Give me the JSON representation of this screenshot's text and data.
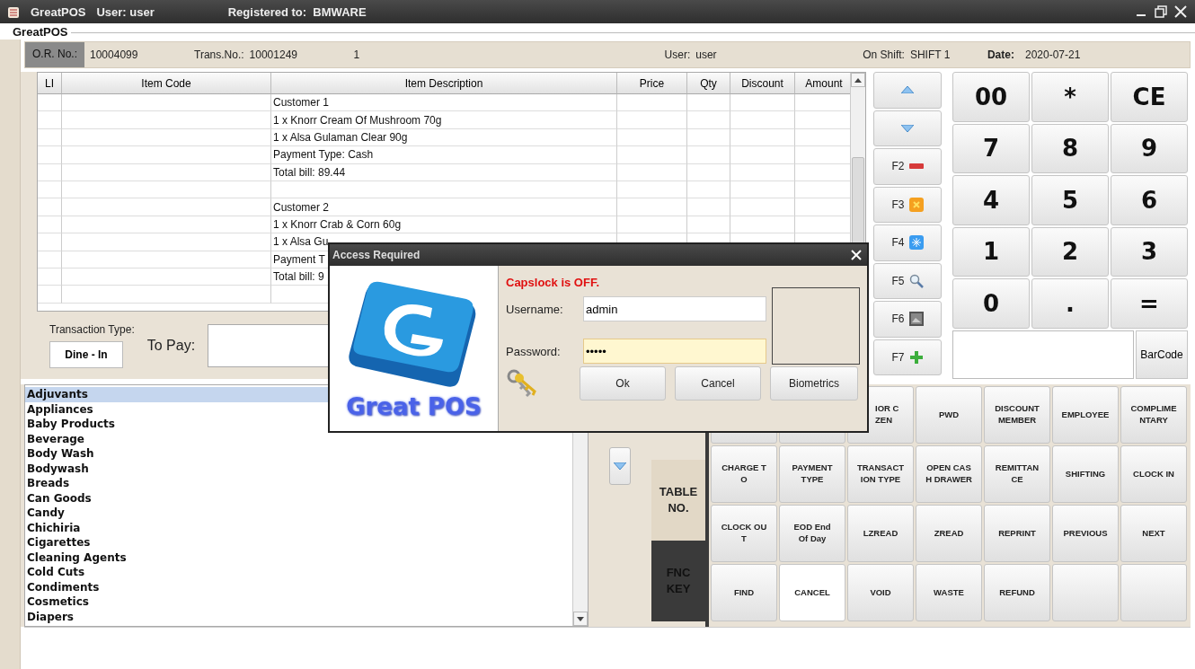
{
  "title_bar": {
    "app": "GreatPOS",
    "user": "User: user",
    "registered": "Registered to:  BMWARE"
  },
  "group_title": "GreatPOS",
  "header": {
    "or_label": "O.R. No.:",
    "or_no": "10004099",
    "trans_label": "Trans.No.:",
    "trans_no": "10001249",
    "counter": "1",
    "user_label": "User:",
    "user": "user",
    "shift_label": "On Shift:",
    "shift": "SHIFT 1",
    "date_label": "Date:",
    "date": "2020-07-21"
  },
  "table": {
    "columns": [
      "LI",
      "Item Code",
      "Item Description",
      "Price",
      "Qty",
      "Discount",
      "Amount"
    ],
    "rows": [
      {
        "kind": "text",
        "description": "Customer 1"
      },
      {
        "kind": "text",
        "description": "1 x Knorr Cream Of Mushroom 70g"
      },
      {
        "kind": "text",
        "description": "1 x Alsa Gulaman Clear 90g"
      },
      {
        "kind": "text",
        "description": "Payment Type: Cash"
      },
      {
        "kind": "text",
        "description": "Total bill: 89.44"
      },
      {
        "kind": "blank"
      },
      {
        "kind": "text",
        "description": "Customer 2"
      },
      {
        "kind": "text",
        "description": "1 x Knorr Crab & Corn 60g"
      },
      {
        "kind": "text",
        "description": "1 x Alsa Gu"
      },
      {
        "kind": "text",
        "description": "Payment T"
      },
      {
        "kind": "text",
        "description": "Total bill: 9"
      },
      {
        "kind": "blank"
      }
    ]
  },
  "transaction": {
    "type_label": "Transaction Type:",
    "type": "Dine - In",
    "to_pay_label": "To Pay:"
  },
  "dialog": {
    "title": "Access Required",
    "logo_text": "Great POS",
    "caps_status": "Capslock is OFF.",
    "username_label": "Username:",
    "username": "admin",
    "password_label": "Password:",
    "password": "•••••",
    "buttons": [
      "Ok",
      "Cancel",
      "Biometrics"
    ]
  },
  "nav_keys": [
    {
      "kind": "up"
    },
    {
      "kind": "down"
    },
    {
      "kind": "minus",
      "label": "F2"
    },
    {
      "kind": "x",
      "label": "F3"
    },
    {
      "kind": "snow",
      "label": "F4"
    },
    {
      "kind": "search",
      "label": "F5"
    },
    {
      "kind": "image",
      "label": "F6"
    },
    {
      "kind": "plus",
      "label": "F7"
    }
  ],
  "keypad": [
    "00",
    "*",
    "CE",
    "7",
    "8",
    "9",
    "4",
    "5",
    "6",
    "1",
    "2",
    "3",
    "0",
    ".",
    "="
  ],
  "barcode_button": "BarCode",
  "categories": [
    {
      "label": "Adjuvants",
      "selected": true
    },
    {
      "label": "Appliances",
      "selected": false
    },
    {
      "label": "Baby Products",
      "selected": false
    },
    {
      "label": "Beverage",
      "selected": false
    },
    {
      "label": "Body Wash",
      "selected": false
    },
    {
      "label": "Bodywash",
      "selected": false
    },
    {
      "label": "Breads",
      "selected": false
    },
    {
      "label": "Can Goods",
      "selected": false
    },
    {
      "label": "Candy",
      "selected": false
    },
    {
      "label": "Chichiria",
      "selected": false
    },
    {
      "label": "Cigarettes",
      "selected": false
    },
    {
      "label": "Cleaning Agents",
      "selected": false
    },
    {
      "label": "Cold Cuts",
      "selected": false
    },
    {
      "label": "Condiments",
      "selected": false
    },
    {
      "label": "Cosmetics",
      "selected": false
    },
    {
      "label": "Diapers",
      "selected": false
    }
  ],
  "side_tabs": [
    {
      "label": "TABLE NO.",
      "selected": false
    },
    {
      "label": "FNC KEY",
      "selected": true
    }
  ],
  "function_keys": [
    {
      "kind": "blank",
      "selected": false
    },
    {
      "kind": "blank",
      "selected": false
    },
    {
      "kind": "partial",
      "label": "IOR C\nZEN",
      "selected": false
    },
    {
      "kind": "key",
      "label": "PWD",
      "selected": false
    },
    {
      "kind": "key",
      "label": "DISCOUNT\nMEMBER",
      "selected": false
    },
    {
      "kind": "key",
      "label": "EMPLOYEE",
      "selected": false
    },
    {
      "kind": "key",
      "label": "COMPLIME\nNTARY",
      "selected": false
    },
    {
      "kind": "key",
      "label": "CHARGE T\nO",
      "selected": false
    },
    {
      "kind": "key",
      "label": "PAYMENT\nTYPE",
      "selected": false
    },
    {
      "kind": "key",
      "label": "TRANSACT\nION TYPE",
      "selected": false
    },
    {
      "kind": "key",
      "label": "OPEN CAS\nH DRAWER",
      "selected": false
    },
    {
      "kind": "key",
      "label": "REMITTAN\nCE",
      "selected": false
    },
    {
      "kind": "key",
      "label": "SHIFTING",
      "selected": false
    },
    {
      "kind": "key",
      "label": "CLOCK IN",
      "selected": false
    },
    {
      "kind": "key",
      "label": "CLOCK OU\nT",
      "selected": false
    },
    {
      "kind": "key",
      "label": "EOD End\nOf Day",
      "selected": false
    },
    {
      "kind": "key",
      "label": "LZREAD",
      "selected": false
    },
    {
      "kind": "key",
      "label": "ZREAD",
      "selected": false
    },
    {
      "kind": "key",
      "label": "REPRINT",
      "selected": false
    },
    {
      "kind": "key",
      "label": "PREVIOUS",
      "selected": false
    },
    {
      "kind": "key",
      "label": "NEXT",
      "selected": false
    },
    {
      "kind": "key",
      "label": "FIND",
      "selected": false
    },
    {
      "kind": "key",
      "label": "CANCEL",
      "selected": true
    },
    {
      "kind": "key",
      "label": "VOID",
      "selected": false
    },
    {
      "kind": "key",
      "label": "WASTE",
      "selected": false
    },
    {
      "kind": "key",
      "label": "REFUND",
      "selected": false
    },
    {
      "kind": "blank",
      "selected": false
    },
    {
      "kind": "blank",
      "selected": false
    }
  ]
}
